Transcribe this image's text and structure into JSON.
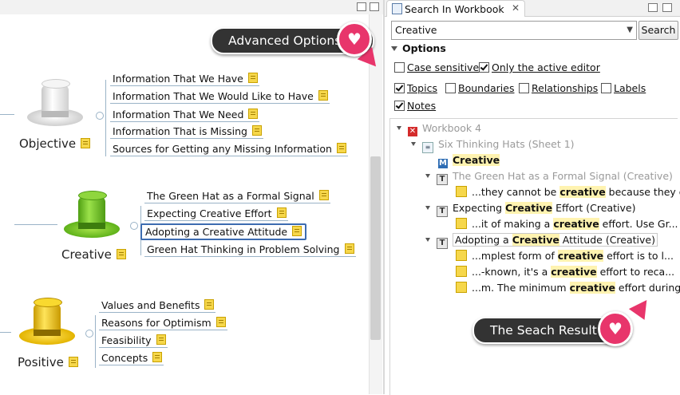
{
  "left_panel": {
    "objective": {
      "label": "Objective",
      "topics": [
        "Information That We Have",
        "Information That We Would Like to Have",
        "Information That We Need",
        "Information That is Missing",
        "Sources for Getting any Missing Information"
      ]
    },
    "creative": {
      "label": "Creative",
      "topics": [
        "The Green Hat as a Formal Signal",
        "Expecting Creative Effort",
        "Adopting a Creative Attitude",
        "Green Hat Thinking in Problem Solving"
      ]
    },
    "positive": {
      "label": "Positive",
      "topics": [
        "Values and Benefits",
        "Reasons for Optimism",
        "Feasibility",
        "Concepts"
      ]
    }
  },
  "callouts": {
    "advanced": "Advanced Options",
    "result": "The Seach Result"
  },
  "search_view": {
    "tab_title": "Search In Workbook",
    "query": "Creative",
    "search_button": "Search",
    "options_title": "Options",
    "case_sensitive": "Case sensitive",
    "only_active": "Only the active editor",
    "topics": "Topics",
    "boundaries": "Boundaries",
    "relationships": "Relationships",
    "labels": "Labels",
    "notes": "Notes",
    "checked": {
      "case_sensitive": false,
      "only_active": true,
      "topics": true,
      "boundaries": false,
      "relationships": false,
      "labels": false,
      "notes": true
    }
  },
  "results": {
    "workbook": "Workbook 4",
    "sheet": "Six Thinking Hats (Sheet 1)",
    "match_main": "Creative",
    "green_hat": "The Green Hat as a Formal Signal (Creative)",
    "green_hat_note_pre": "...they cannot be ",
    "green_hat_note_hl": "creative",
    "green_hat_note_post": " because they d...",
    "expecting_pre": "Expecting ",
    "expecting_hl": "Creative",
    "expecting_post": " Effort (Creative)",
    "expecting_note_pre": "...it of making a ",
    "expecting_note_hl": "creative",
    "expecting_note_post": " effort. Use Gr...",
    "adopting_pre": "Adopting a ",
    "adopting_hl": "Creative",
    "adopting_post": " Attitude (Creative)",
    "adopting_note1_pre": "...mplest form of ",
    "adopting_note1_hl": "creative",
    "adopting_note1_post": " effort is to l...",
    "adopting_note2_pre": "...-known, it's a ",
    "adopting_note2_hl": "creative",
    "adopting_note2_post": " effort to reca...",
    "adopting_note3_pre": "...m. The minimum ",
    "adopting_note3_hl": "creative",
    "adopting_note3_post": " effort during ..."
  },
  "colors": {
    "accent": "#e8356b",
    "callout_bg": "#333333",
    "selection": "#3d6cb0",
    "highlight": "#fff3b0"
  }
}
